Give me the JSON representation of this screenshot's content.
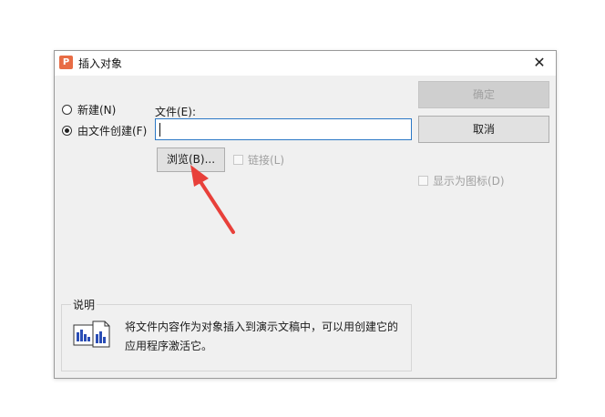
{
  "dialog": {
    "title": "插入对象",
    "app_icon_letter": "P",
    "close_symbol": "✕"
  },
  "options": {
    "new_label": "新建(N)",
    "from_file_label": "由文件创建(F)",
    "selected": "from_file"
  },
  "file": {
    "label": "文件(E):",
    "value": ""
  },
  "buttons": {
    "browse": "浏览(B)...",
    "ok": "确定",
    "cancel": "取消"
  },
  "checkboxes": {
    "link": "链接(L)",
    "display_as_icon": "显示为图标(D)"
  },
  "description": {
    "title": "说明",
    "text": "将文件内容作为对象插入到演示文稿中，可以用创建它的应用程序激活它。"
  },
  "annotation": {
    "arrow_color": "#e8403a"
  }
}
